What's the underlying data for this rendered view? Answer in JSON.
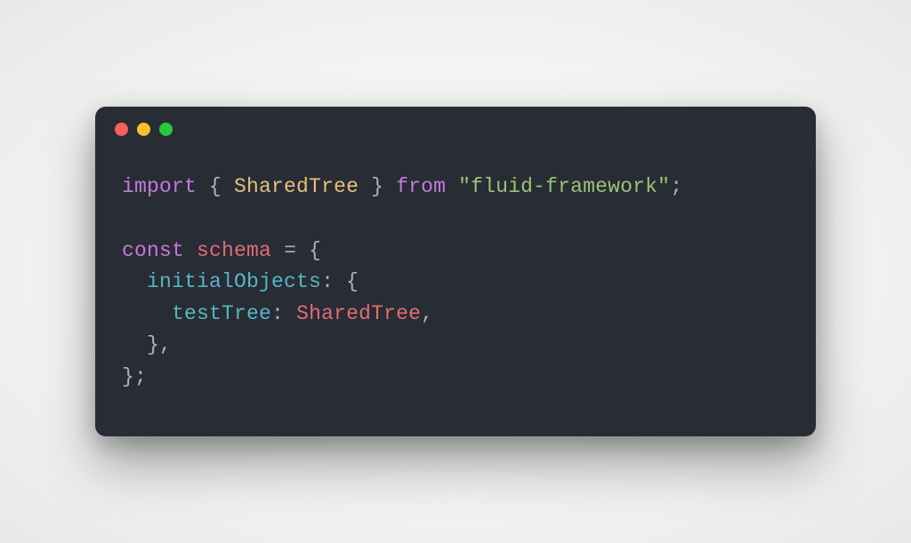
{
  "window": {
    "colors": {
      "close": "#ff5f56",
      "minimize": "#ffbd2e",
      "zoom": "#27c93f"
    }
  },
  "code": {
    "line1": {
      "import": "import",
      "space1": " ",
      "brace_open": "{ ",
      "ident": "SharedTree",
      "brace_close": " }",
      "space2": " ",
      "from": "from",
      "space3": " ",
      "string": "\"fluid-framework\"",
      "semi": ";"
    },
    "blank": "",
    "line3": {
      "const": "const",
      "space1": " ",
      "var": "schema",
      "space2": " ",
      "eq": "=",
      "space3": " ",
      "brace": "{"
    },
    "line4": {
      "indent": "  ",
      "prop": "initialObjects",
      "colon": ": ",
      "brace": "{"
    },
    "line5": {
      "indent": "    ",
      "prop": "testTree",
      "colon": ": ",
      "type": "SharedTree",
      "comma": ","
    },
    "line6": {
      "indent": "  ",
      "brace": "}",
      "comma": ","
    },
    "line7": {
      "brace": "}",
      "semi": ";"
    }
  }
}
